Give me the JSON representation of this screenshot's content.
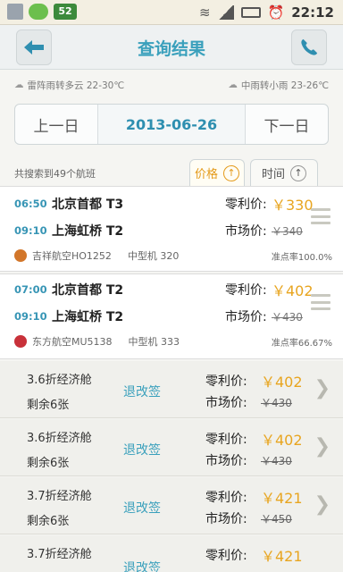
{
  "status_bar": {
    "badge": "52",
    "time": "22:12"
  },
  "header": {
    "title": "查询结果",
    "back_icon": "back-arrow-icon",
    "phone_icon": "phone-icon"
  },
  "weather": {
    "left": "雷阵雨转多云 22-30℃",
    "right": "中雨转小雨 23-26℃"
  },
  "date_bar": {
    "prev": "上一日",
    "current": "2013-06-26",
    "next": "下一日"
  },
  "summary": "共搜索到49个航班",
  "sort_tabs": [
    {
      "label": "价格",
      "active": true
    },
    {
      "label": "时间",
      "active": false
    }
  ],
  "flights": [
    {
      "dep_time": "06:50",
      "dep_airport": "北京首都 T3",
      "arr_time": "09:10",
      "arr_airport": "上海虹桥 T2",
      "price_label": "零利价:",
      "price": "￥330",
      "market_label": "市场价:",
      "market_price": "￥340",
      "airline": "吉祥航空HO1252",
      "aircraft": "中型机 320",
      "ontime": "准点率100.0%",
      "logo_color": "#d2762a"
    },
    {
      "dep_time": "07:00",
      "dep_airport": "北京首都 T2",
      "arr_time": "09:10",
      "arr_airport": "上海虹桥 T2",
      "price_label": "零利价:",
      "price": "￥402",
      "market_label": "市场价:",
      "market_price": "￥430",
      "airline": "东方航空MU5138",
      "aircraft": "中型机 333",
      "ontime": "准点率66.67%",
      "logo_color": "#c8313a"
    }
  ],
  "cabins": [
    {
      "name": "3.6折经济舱",
      "remain": "剩余6张",
      "refund": "退改签",
      "price_label": "零利价:",
      "price": "￥402",
      "market_label": "市场价:",
      "market_price": "￥430"
    },
    {
      "name": "3.6折经济舱",
      "remain": "剩余6张",
      "refund": "退改签",
      "price_label": "零利价:",
      "price": "￥402",
      "market_label": "市场价:",
      "market_price": "￥430"
    },
    {
      "name": "3.7折经济舱",
      "remain": "剩余6张",
      "refund": "退改签",
      "price_label": "零利价:",
      "price": "￥421",
      "market_label": "市场价:",
      "market_price": "￥450"
    },
    {
      "name": "3.7折经济舱",
      "remain": "",
      "refund": "退改签",
      "price_label": "零利价:",
      "price": "￥421",
      "market_label": "",
      "market_price": ""
    }
  ]
}
